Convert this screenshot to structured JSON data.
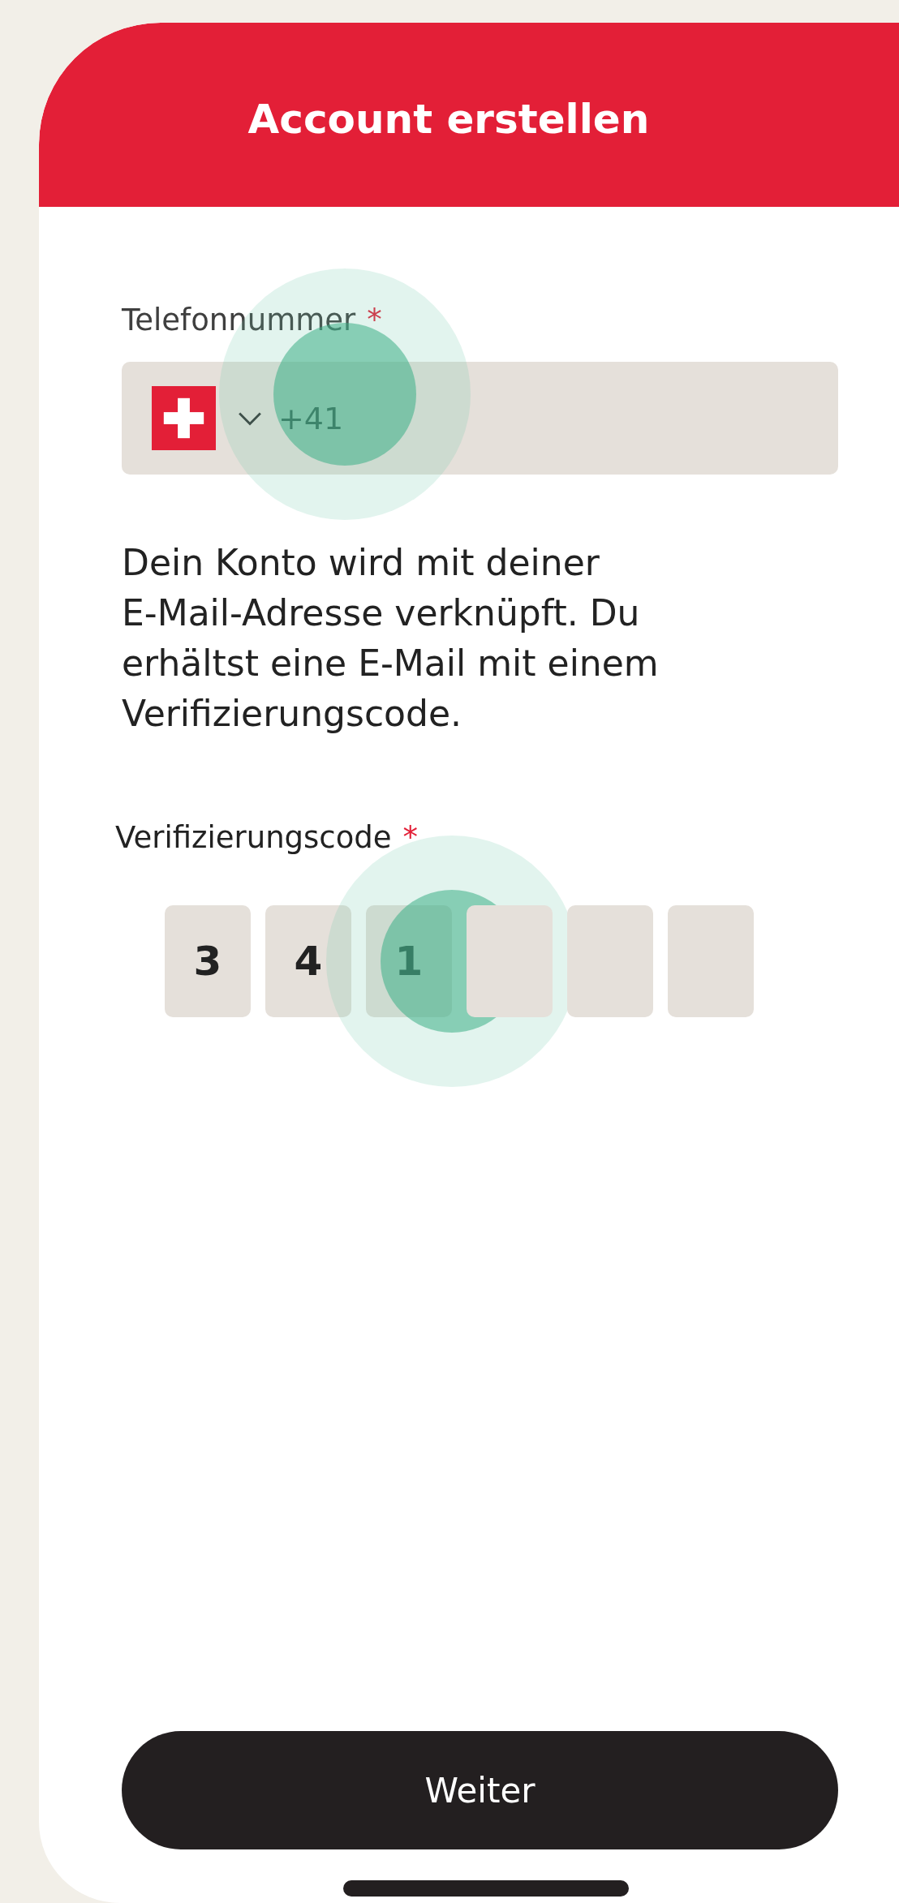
{
  "header": {
    "title": "Account erstellen"
  },
  "phone": {
    "label": "Telefonnummer",
    "required_mark": "*",
    "dial_code": "+41",
    "tapped": true
  },
  "description": "Dein Konto wird mit deiner E-Mail-Adresse verknüpft. Du erhältst eine E-Mail mit einem Verifizierungscode.",
  "code": {
    "label": "Verifizierungscode",
    "required_mark": "*",
    "boxes": [
      {
        "digit": "3",
        "tapped": false
      },
      {
        "digit": "4",
        "tapped": false
      },
      {
        "digit": "1",
        "tapped": true
      },
      {
        "tapped": false
      },
      {
        "tapped": false
      },
      {
        "tapped": false
      }
    ]
  },
  "button": {
    "label": "Weiter"
  }
}
